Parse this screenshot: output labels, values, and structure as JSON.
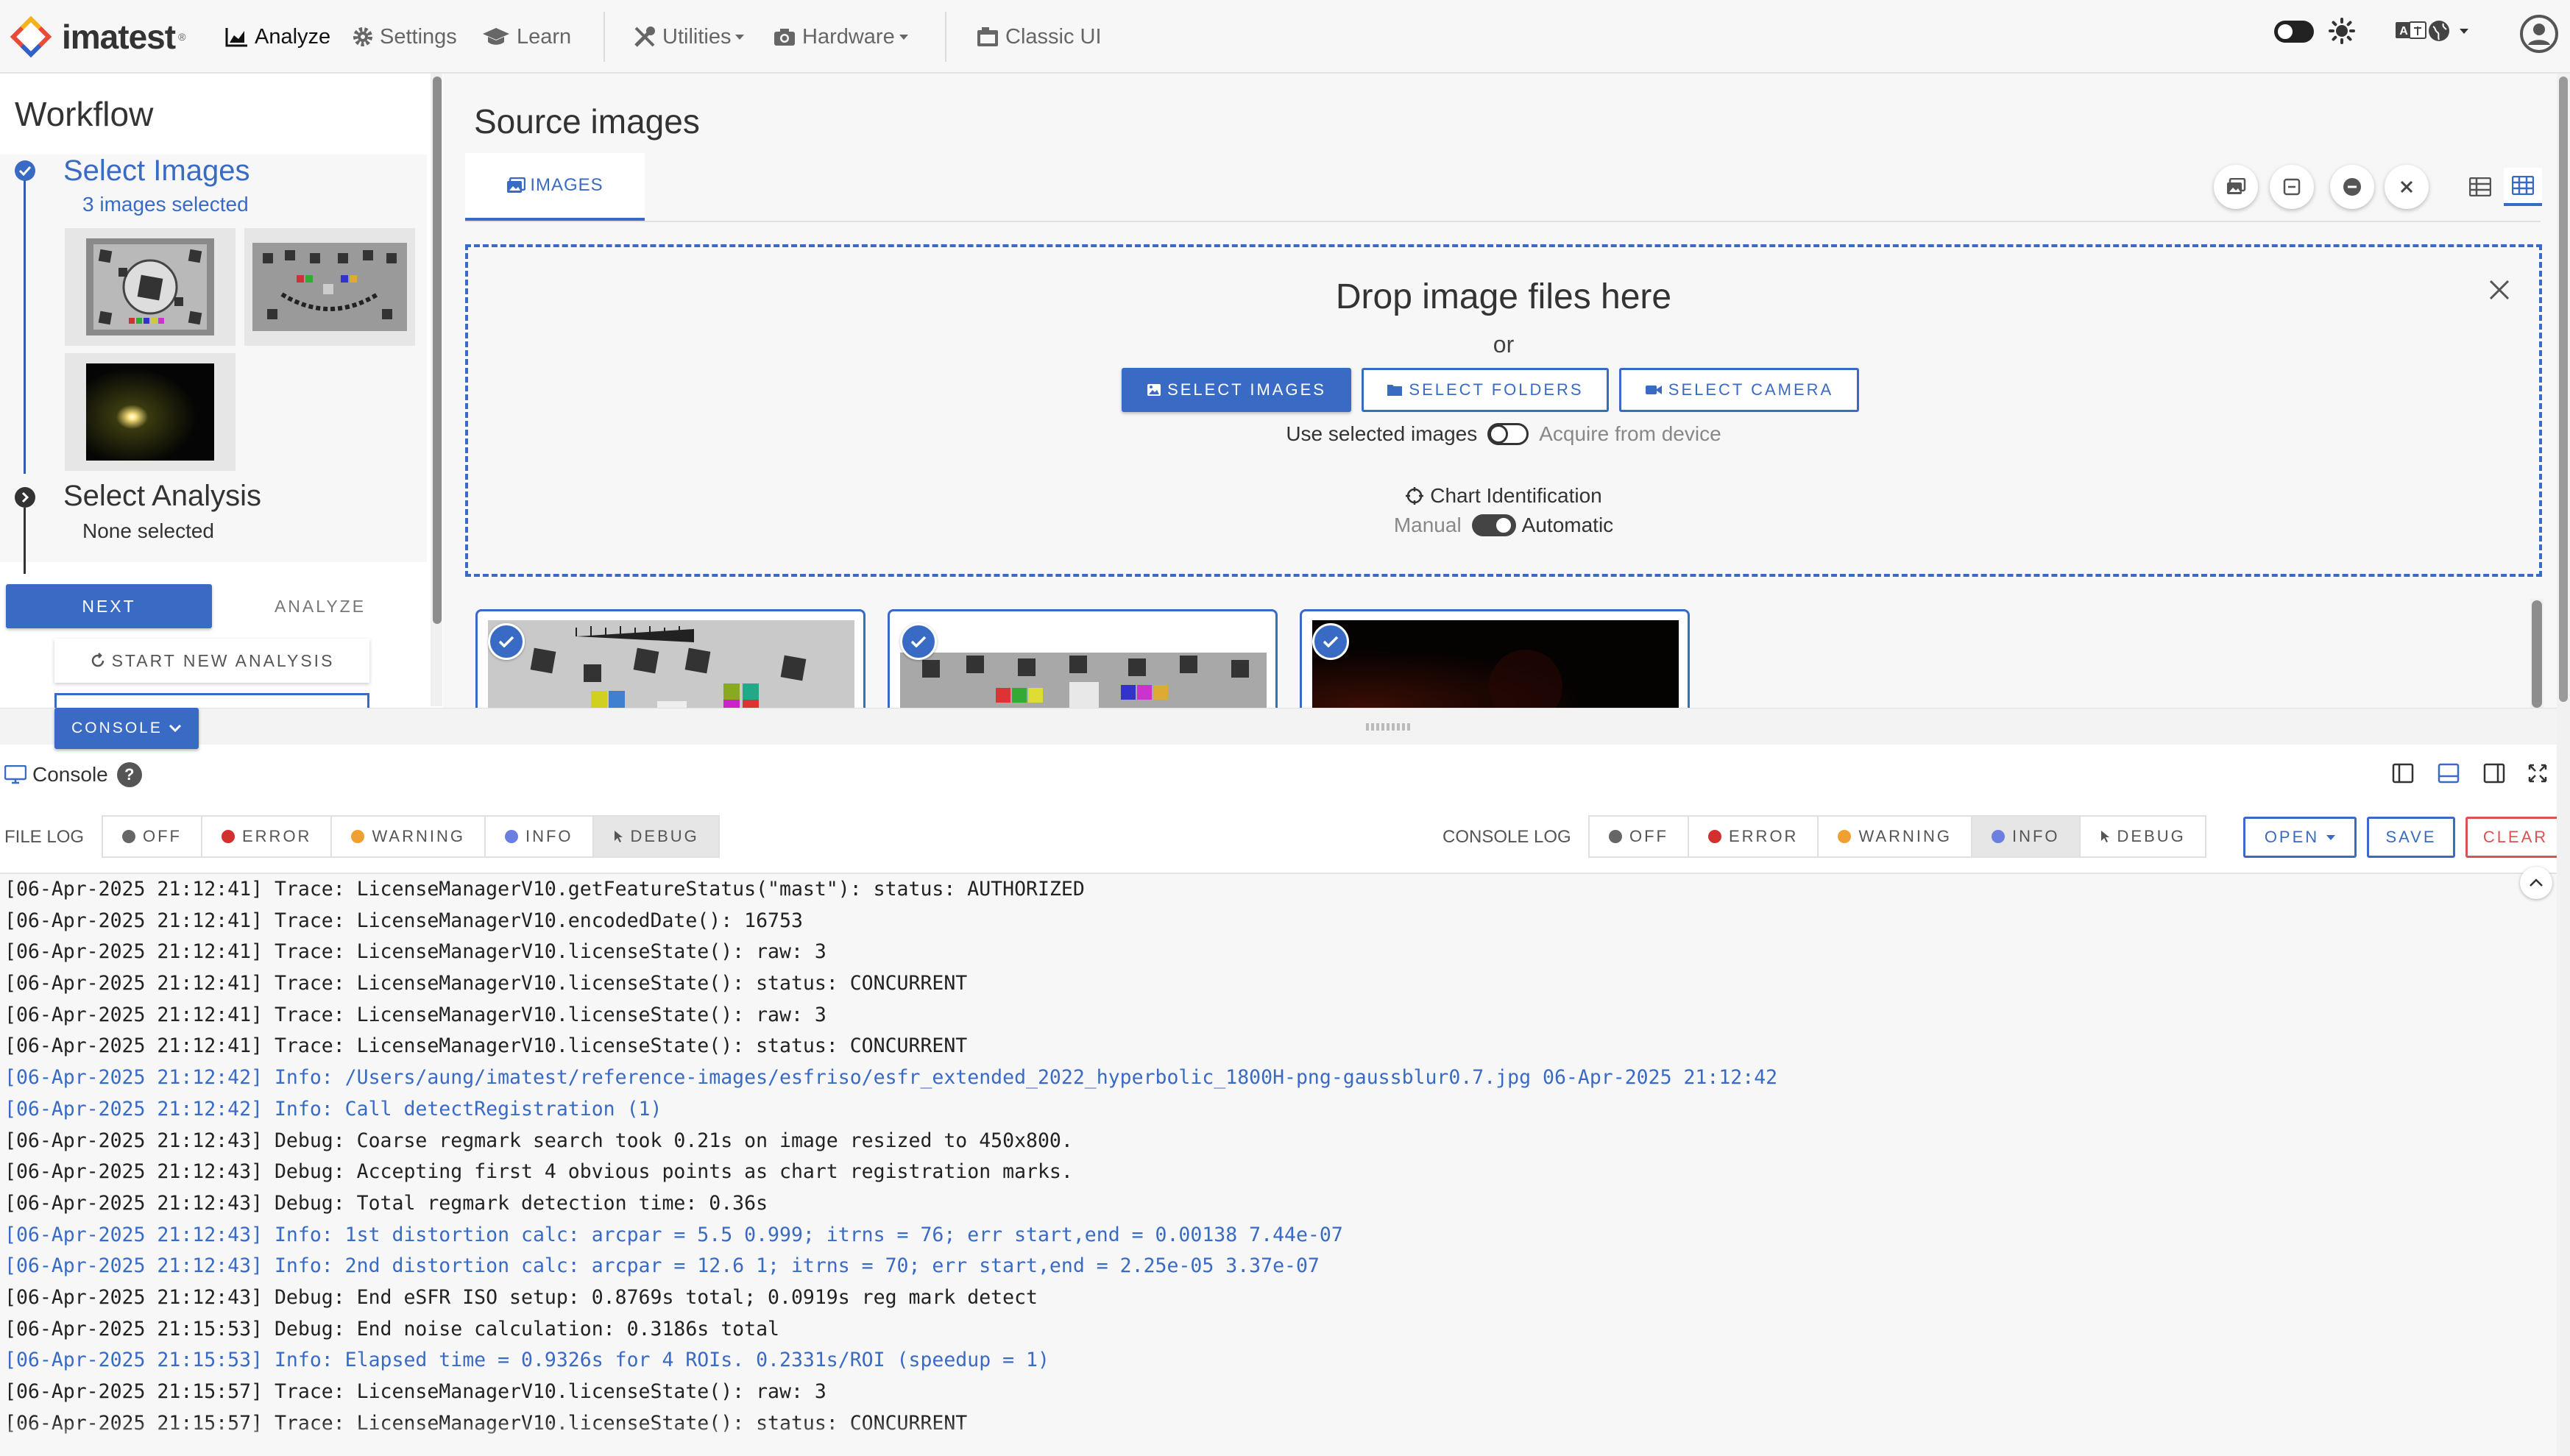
{
  "nav": {
    "brand": "imatest",
    "brand_mark": "®",
    "items": [
      {
        "label": "Analyze",
        "icon": "chart-area-icon"
      },
      {
        "label": "Settings",
        "icon": "gear-icon"
      },
      {
        "label": "Learn",
        "icon": "graduation-cap-icon"
      },
      {
        "label": "Utilities",
        "icon": "tools-icon"
      },
      {
        "label": "Hardware",
        "icon": "camera-icon"
      },
      {
        "label": "Classic UI",
        "icon": "window-icon"
      }
    ],
    "right_icons": [
      "theme-toggle-icon",
      "sun-icon",
      "language-icon",
      "globe-icon",
      "user-icon"
    ]
  },
  "workflow": {
    "title": "Workflow",
    "step1": {
      "title": "Select Images",
      "subtitle": "3 images selected"
    },
    "step2": {
      "title": "Select Analysis",
      "subtitle": "None selected"
    },
    "next_label": "NEXT",
    "analyze_label": "ANALYZE",
    "new_analysis_label": "START NEW ANALYSIS"
  },
  "source": {
    "title": "Source images",
    "tab_label": "IMAGES",
    "toolbar_icons": [
      "image-icon",
      "collapse-icon",
      "minus-circle-icon",
      "close-icon",
      "list-view-icon",
      "grid-view-icon"
    ],
    "dropzone": {
      "title": "Drop image files here",
      "or": "or",
      "select_images": "SELECT IMAGES",
      "select_folders": "SELECT FOLDERS",
      "select_camera": "SELECT CAMERA",
      "use_selected": "Use selected images",
      "acquire": "Acquire from device",
      "chart_id": "Chart Identification",
      "manual": "Manual",
      "automatic": "Automatic"
    }
  },
  "console_toggle_label": "CONSOLE",
  "console": {
    "title": "Console",
    "help": "?",
    "file_log_label": "FILE LOG",
    "console_log_label": "CONSOLE LOG",
    "file_levels": [
      {
        "label": "OFF",
        "color": "#666666"
      },
      {
        "label": "ERROR",
        "color": "#d32f2f"
      },
      {
        "label": "WARNING",
        "color": "#f0a030"
      },
      {
        "label": "INFO",
        "color": "#6b7fe0"
      },
      {
        "label": "DEBUG",
        "color": "#555555"
      }
    ],
    "file_selected": "DEBUG",
    "console_selected": "INFO",
    "open_label": "OPEN",
    "save_label": "SAVE",
    "clear_label": "CLEAR",
    "lines": [
      {
        "text": "[06-Apr-2025 21:12:41] Trace: LicenseManagerV10.getFeatureStatus(\"mast\"): status: AUTHORIZED",
        "level": "trace"
      },
      {
        "text": "[06-Apr-2025 21:12:41] Trace: LicenseManagerV10.encodedDate(): 16753",
        "level": "trace"
      },
      {
        "text": "[06-Apr-2025 21:12:41] Trace: LicenseManagerV10.licenseState(): raw: 3",
        "level": "trace"
      },
      {
        "text": "[06-Apr-2025 21:12:41] Trace: LicenseManagerV10.licenseState(): status: CONCURRENT",
        "level": "trace"
      },
      {
        "text": "[06-Apr-2025 21:12:41] Trace: LicenseManagerV10.licenseState(): raw: 3",
        "level": "trace"
      },
      {
        "text": "[06-Apr-2025 21:12:41] Trace: LicenseManagerV10.licenseState(): status: CONCURRENT",
        "level": "trace"
      },
      {
        "text": "[06-Apr-2025 21:12:42] Info: /Users/aung/imatest/reference-images/esfriso/esfr_extended_2022_hyperbolic_1800H-png-gaussblur0.7.jpg 06-Apr-2025 21:12:42",
        "level": "info"
      },
      {
        "text": "[06-Apr-2025 21:12:42] Info: Call detectRegistration (1)",
        "level": "info"
      },
      {
        "text": "[06-Apr-2025 21:12:43] Debug: Coarse regmark search took 0.21s on image resized to 450x800.",
        "level": "debug"
      },
      {
        "text": "[06-Apr-2025 21:12:43] Debug: Accepting first 4 obvious points as chart registration marks.",
        "level": "debug"
      },
      {
        "text": "[06-Apr-2025 21:12:43] Debug: Total regmark detection time: 0.36s",
        "level": "debug"
      },
      {
        "text": "[06-Apr-2025 21:12:43] Info: 1st distortion calc: arcpar = 5.5 0.999; itrns = 76; err start,end = 0.00138 7.44e-07",
        "level": "info"
      },
      {
        "text": "[06-Apr-2025 21:12:43] Info: 2nd distortion calc: arcpar = 12.6 1; itrns = 70; err start,end = 2.25e-05 3.37e-07",
        "level": "info"
      },
      {
        "text": "[06-Apr-2025 21:12:43] Debug: End eSFR ISO setup: 0.8769s total; 0.0919s reg mark detect",
        "level": "debug"
      },
      {
        "text": "[06-Apr-2025 21:15:53] Debug: End noise calculation: 0.3186s total",
        "level": "debug"
      },
      {
        "text": "[06-Apr-2025 21:15:53] Info: Elapsed time = 0.9326s for 4 ROIs. 0.2331s/ROI (speedup = 1)",
        "level": "info"
      },
      {
        "text": "[06-Apr-2025 21:15:57] Trace: LicenseManagerV10.licenseState(): raw: 3",
        "level": "trace"
      },
      {
        "text": "[06-Apr-2025 21:15:57] Trace: LicenseManagerV10.licenseState(): status: CONCURRENT",
        "level": "trace"
      }
    ]
  },
  "colors": {
    "accent": "#3a6bc4",
    "danger": "#d9534f"
  }
}
